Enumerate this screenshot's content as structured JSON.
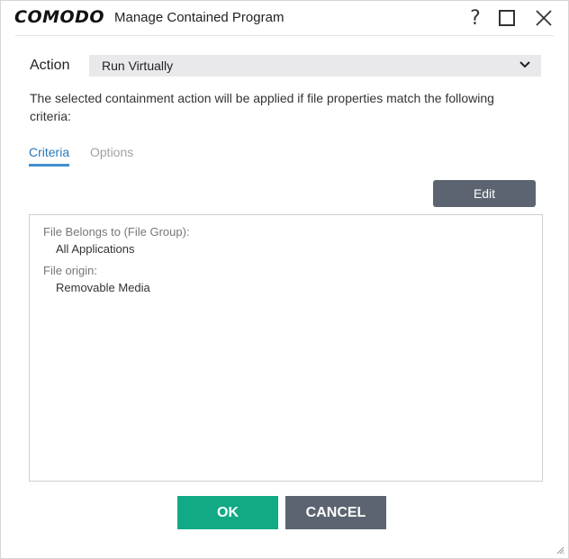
{
  "window": {
    "brand": "COMODO",
    "title": "Manage Contained Program",
    "help_glyph": "?"
  },
  "action": {
    "label": "Action",
    "selected": "Run Virtually"
  },
  "description": "The selected containment action will be applied if file properties match the following criteria:",
  "tabs": [
    {
      "label": "Criteria",
      "active": true
    },
    {
      "label": "Options",
      "active": false
    }
  ],
  "edit_label": "Edit",
  "criteria": [
    {
      "label": "File Belongs to (File Group):",
      "value": "All Applications"
    },
    {
      "label": "File origin:",
      "value": "Removable Media"
    }
  ],
  "buttons": {
    "ok": "OK",
    "cancel": "CANCEL"
  },
  "colors": {
    "ok_green": "#12aa85",
    "slate_button": "#5b6470",
    "tab_active": "#2b78b8",
    "select_bg": "#e9e9ec"
  },
  "icons": [
    "help-icon",
    "maximize-icon",
    "close-icon",
    "chevron-down-icon",
    "resize-grip-icon"
  ]
}
